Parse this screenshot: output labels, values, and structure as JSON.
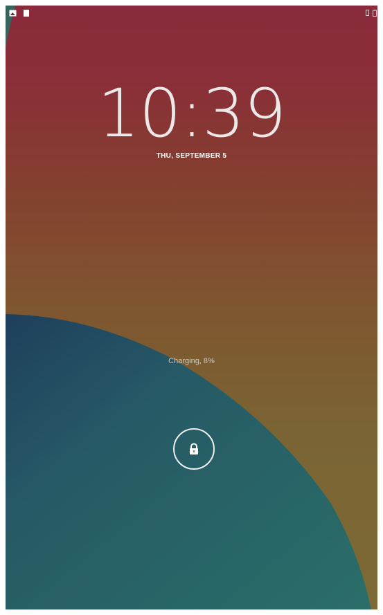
{
  "lockscreen": {
    "time": "10:39",
    "date": "THU, SEPTEMBER 5",
    "charging_status": "Charging, 8%"
  },
  "status_bar": {
    "left_icons": [
      "screenshot-notification-icon",
      "sd-card-notification-icon"
    ],
    "right_icons": [
      "vibrate-icon",
      "battery-icon"
    ]
  },
  "colors": {
    "wallpaper_top": "#8a2a3c",
    "wallpaper_middle": "#7f542f",
    "wallpaper_bottom": "#7d6a36",
    "wallpaper_teal": "#2a6c6a",
    "wallpaper_dark_teal": "#1e3f5c",
    "text": "#ffffff"
  }
}
